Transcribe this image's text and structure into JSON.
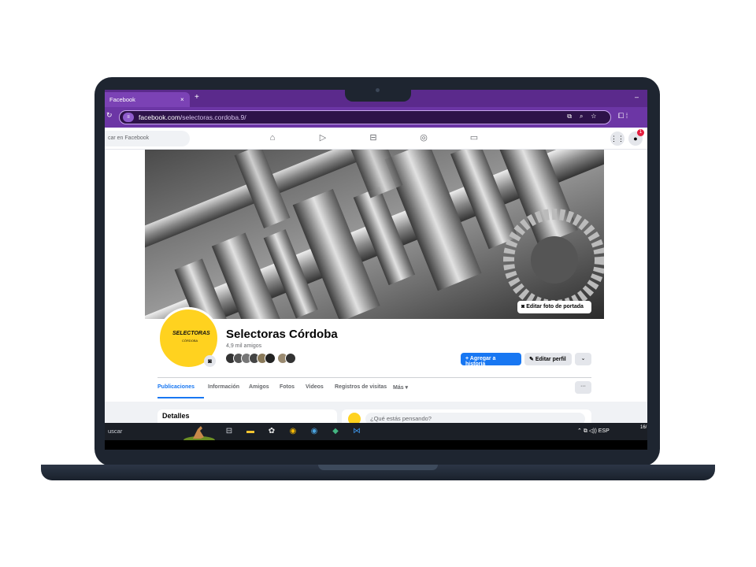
{
  "browser": {
    "tab_title": "Facebook",
    "tab_close": "×",
    "new_tab": "+",
    "window_minimize": "–",
    "url_host": "facebook.com",
    "url_path": "/selectoras.cordoba.9/",
    "site_info_icon": "tune-icon",
    "omnibox_icons": [
      "cast-icon",
      "zoom-icon",
      "star-icon"
    ]
  },
  "facebook": {
    "search_placeholder": "car en Facebook",
    "nav_icons": [
      "home-icon",
      "video-icon",
      "marketplace-icon",
      "groups-icon",
      "gaming-icon"
    ],
    "messenger_badge": "1"
  },
  "profile": {
    "name": "Selectoras Córdoba",
    "friends": "4,9 mil amigos",
    "avatar_text": "SELECTORAS",
    "avatar_sub": "CÓRDOBA",
    "edit_cover": "Editar foto de portada",
    "add_story": "+ Agregar a historia",
    "edit_profile": "Editar perfil",
    "more_button": "⌄",
    "tabs": [
      {
        "label": "Publicaciones",
        "active": true
      },
      {
        "label": "Información"
      },
      {
        "label": "Amigos"
      },
      {
        "label": "Fotos"
      },
      {
        "label": "Videos"
      },
      {
        "label": "Registros de visitas"
      },
      {
        "label": "Más ▾"
      }
    ],
    "tabs_more": "···",
    "details_title": "Detalles",
    "post_placeholder": "¿Qué estás pensando?"
  },
  "taskbar": {
    "search_text": "uscar",
    "tray_text": "ESP",
    "tray_time": "16/"
  },
  "colors": {
    "brand_blue": "#1877f2",
    "chrome_purple": "#6c36a5",
    "avatar_yellow": "#ffd21f"
  }
}
